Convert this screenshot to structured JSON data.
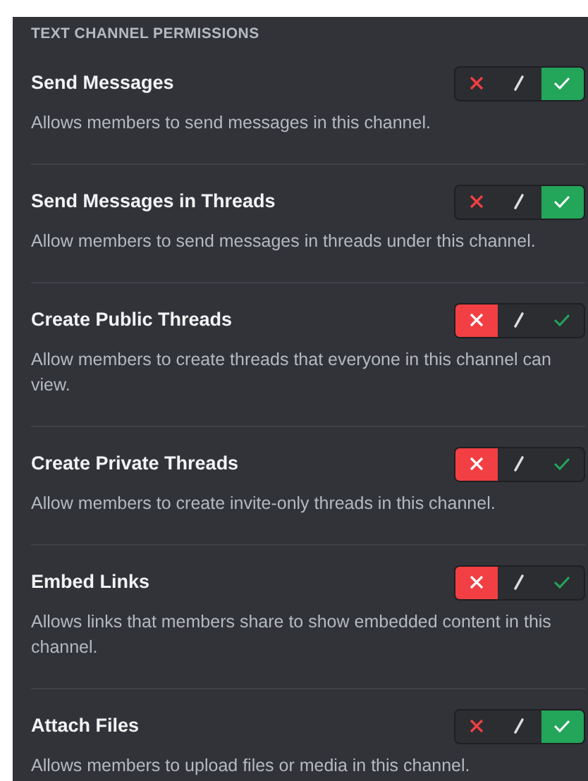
{
  "section_title": "TEXT CHANNEL PERMISSIONS",
  "permissions": [
    {
      "name": "Send Messages",
      "description": "Allows members to send messages in this channel.",
      "denied": false,
      "allowed": true
    },
    {
      "name": "Send Messages in Threads",
      "description": "Allow members to send messages in threads under this channel.",
      "denied": false,
      "allowed": true
    },
    {
      "name": "Create Public Threads",
      "description": "Allow members to create threads that everyone in this channel can view.",
      "denied": true,
      "allowed": false
    },
    {
      "name": "Create Private Threads",
      "description": "Allow members to create invite-only threads in this channel.",
      "denied": true,
      "allowed": false
    },
    {
      "name": "Embed Links",
      "description": "Allows links that members share to show embedded content in this channel.",
      "denied": true,
      "allowed": false
    },
    {
      "name": "Attach Files",
      "description": "Allows members to upload files or media in this channel.",
      "denied": false,
      "allowed": true
    }
  ]
}
